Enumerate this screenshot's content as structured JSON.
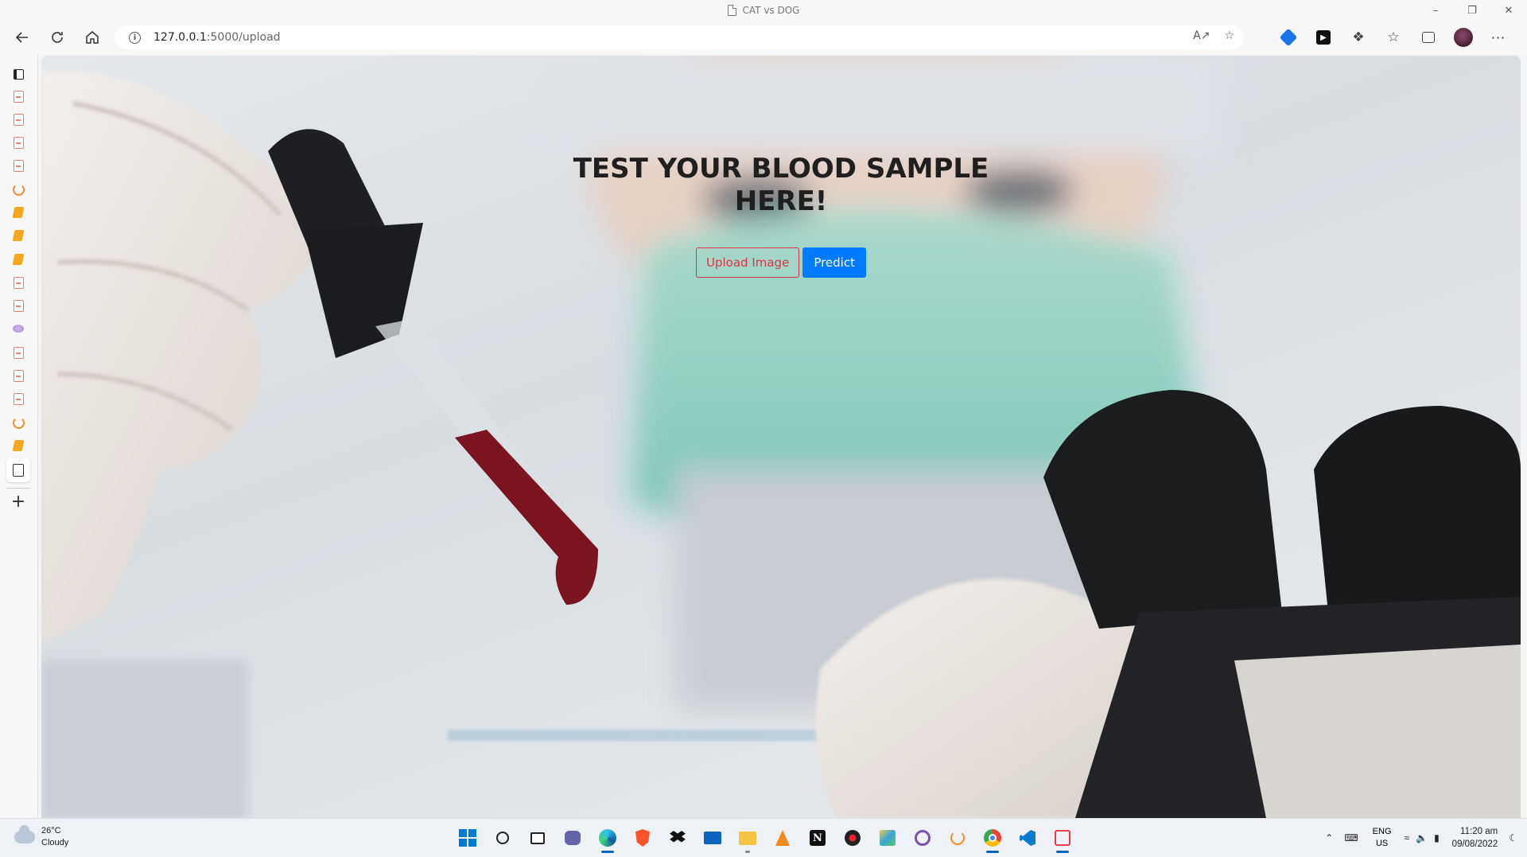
{
  "window": {
    "title": "CAT vs DOG",
    "controls": [
      "minimize",
      "restore",
      "close"
    ]
  },
  "address_bar": {
    "url_host": "127.0.0.1",
    "url_path": ":5000/upload"
  },
  "page": {
    "heading_line1": "TEST YOUR BLOOD SAMPLE",
    "heading_line2": "HERE!",
    "upload_label": "Upload Image",
    "predict_label": "Predict"
  },
  "sidebar": {
    "items": [
      "tab-actions-icon",
      "pdf-icon",
      "pdf-icon",
      "pdf-icon",
      "pdf-icon",
      "jupyter-icon",
      "book-icon",
      "book-icon",
      "book-icon",
      "pdf-icon",
      "pdf-icon",
      "blob-icon",
      "pdf-icon",
      "pdf-icon",
      "pdf-icon",
      "jupyter-icon",
      "book-icon",
      "document-icon"
    ]
  },
  "taskbar": {
    "weather_temp": "26°C",
    "weather_desc": "Cloudy",
    "lang_top": "ENG",
    "lang_bottom": "US",
    "time": "11:20 am",
    "date": "09/08/2022"
  },
  "colors": {
    "upload_border": "#dc3545",
    "predict_bg": "#007bff",
    "accent": "#0067c0"
  }
}
